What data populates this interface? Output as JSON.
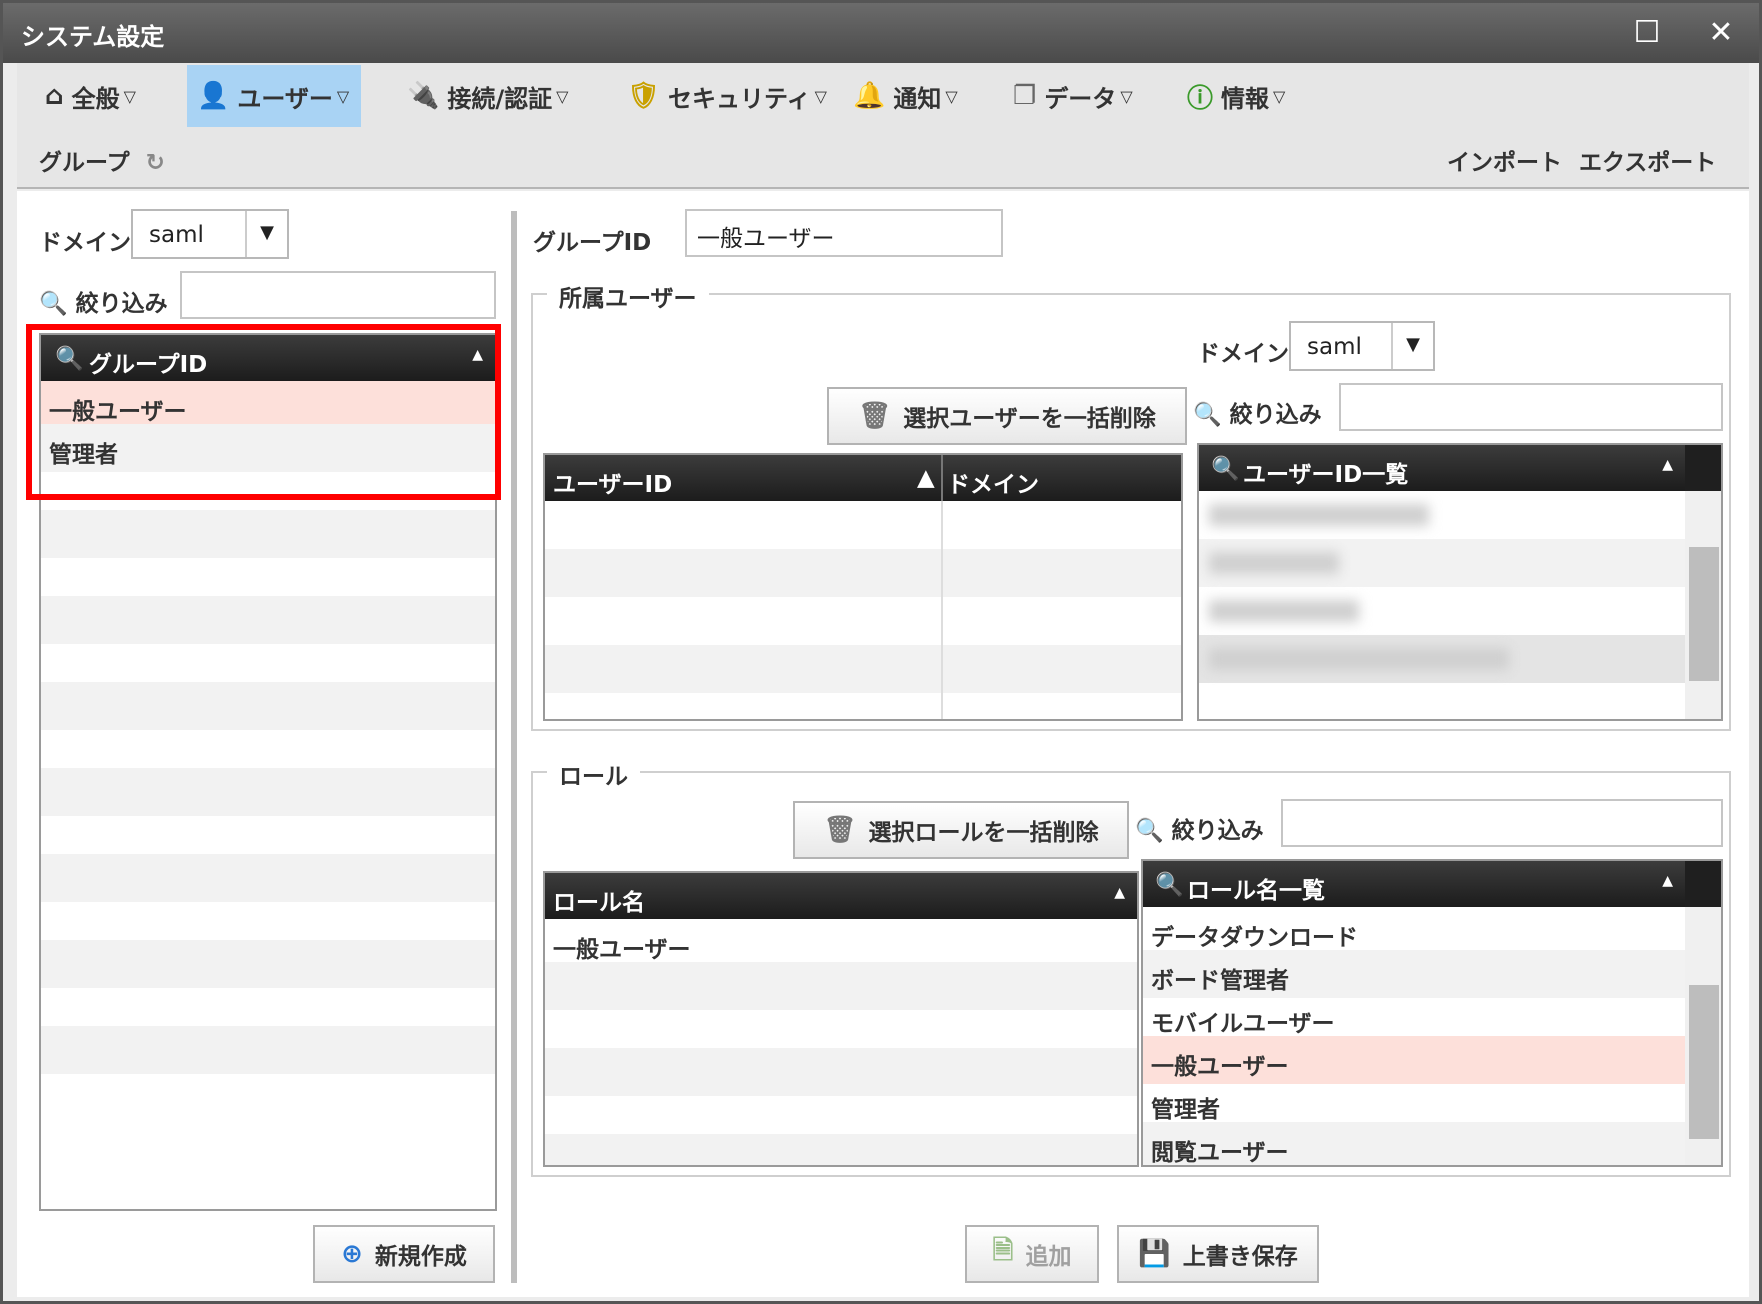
{
  "window": {
    "title": "システム設定",
    "maximize_icon": "maximize-icon",
    "close_icon": "close-icon"
  },
  "menus": [
    {
      "label": "全般",
      "icon": "home-icon"
    },
    {
      "label": "ユーザー",
      "icon": "user-icon"
    },
    {
      "label": "接続/認証",
      "icon": "plug-icon"
    },
    {
      "label": "セキュリティ",
      "icon": "shield-icon"
    },
    {
      "label": "通知",
      "icon": "bell-icon"
    },
    {
      "label": "データ",
      "icon": "documents-icon"
    },
    {
      "label": "情報",
      "icon": "info-icon"
    }
  ],
  "submenu": {
    "group": "グループ",
    "import": "インポート",
    "export": "エクスポート"
  },
  "left": {
    "domain_label": "ドメイン",
    "domain_value": "saml",
    "filter_label": "絞り込み",
    "filter_value": "",
    "grid_header": "グループID",
    "rows": [
      "一般ユーザー",
      "管理者"
    ],
    "new_button": "新規作成"
  },
  "right": {
    "group_id_label": "グループID",
    "group_id_value": "一般ユーザー",
    "members": {
      "legend": "所属ユーザー",
      "domain_label": "ドメイン",
      "domain_value": "saml",
      "filter_label": "絞り込み",
      "delete_button": "選択ユーザーを一括削除",
      "col_user_id": "ユーザーID",
      "col_domain": "ドメイン",
      "list_header": "ユーザーID一覧"
    },
    "roles": {
      "legend": "ロール",
      "filter_label": "絞り込み",
      "delete_button": "選択ロールを一括削除",
      "col_role": "ロール名",
      "assigned": [
        "一般ユーザー"
      ],
      "list_header": "ロール名一覧",
      "list": [
        "データダウンロード",
        "ボード管理者",
        "モバイルユーザー",
        "一般ユーザー",
        "管理者",
        "閲覧ユーザー"
      ],
      "selected": "一般ユーザー"
    },
    "add_button": "追加",
    "save_button": "上書き保存"
  }
}
